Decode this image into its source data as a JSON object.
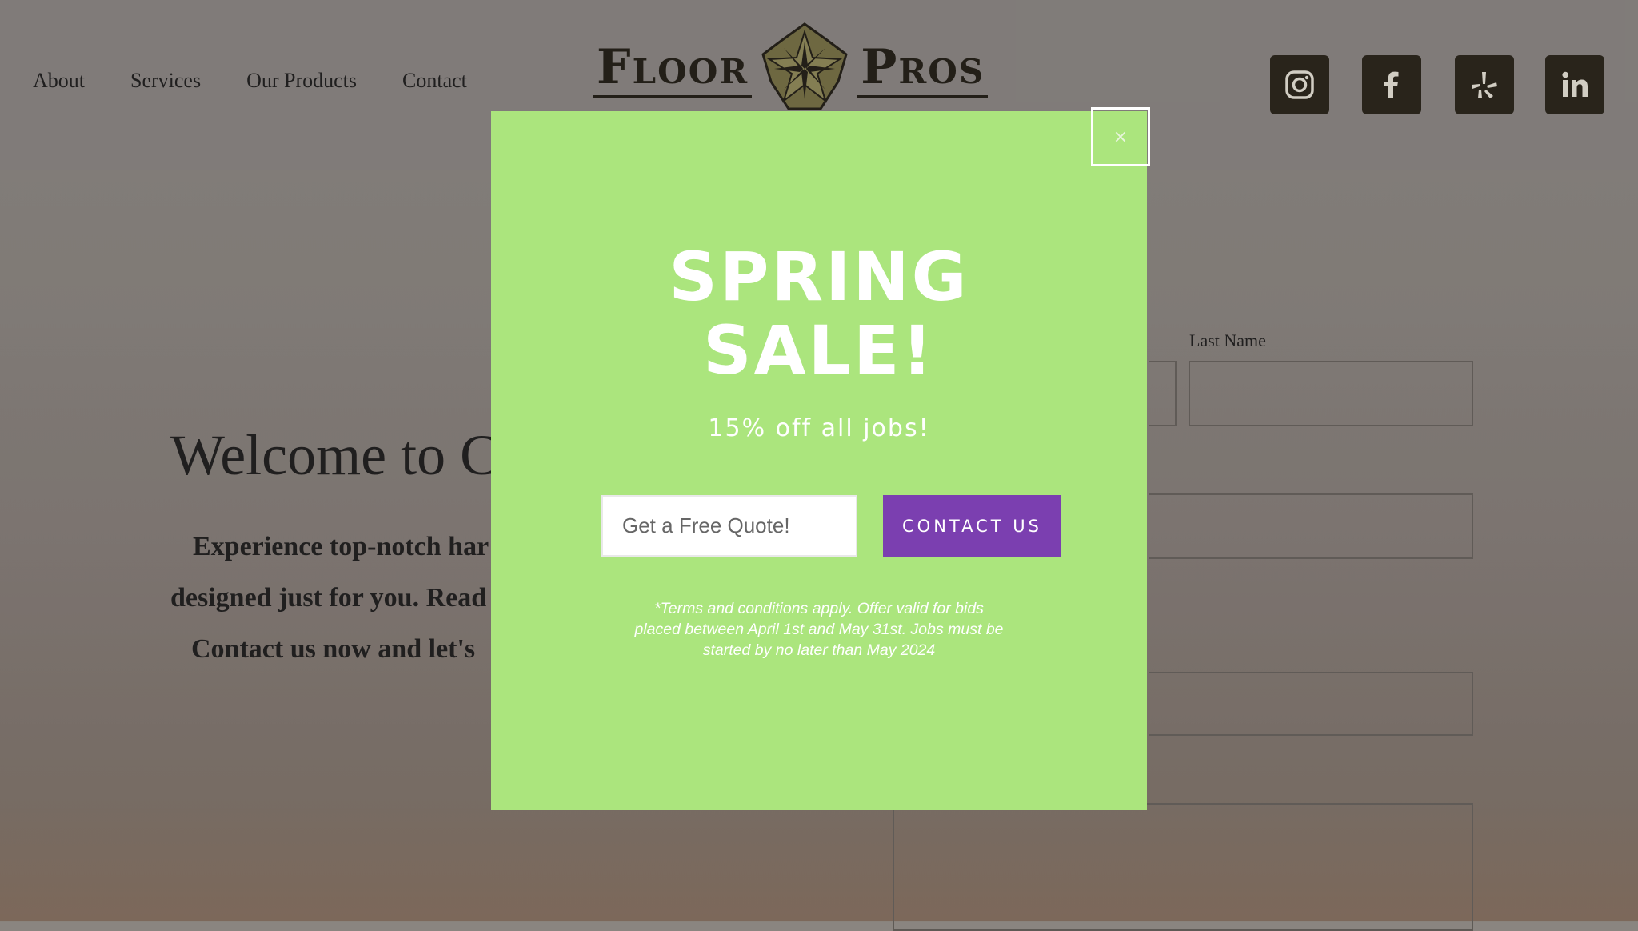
{
  "nav": {
    "items": [
      "About",
      "Services",
      "Our Products",
      "Contact"
    ]
  },
  "logo": {
    "left_word": "Floor",
    "right_word": "Pros",
    "emblem_icon": "star-emblem-icon"
  },
  "social": [
    {
      "name": "instagram",
      "icon": "instagram-icon"
    },
    {
      "name": "facebook",
      "icon": "facebook-icon"
    },
    {
      "name": "yelp",
      "icon": "yelp-icon"
    },
    {
      "name": "linkedin",
      "icon": "linkedin-icon"
    }
  ],
  "page": {
    "welcome": "Welcome to C",
    "intro_lines": [
      "Experience top-notch har",
      "designed just for you. Read",
      "Contact us now and let's"
    ]
  },
  "form": {
    "last_name_label": "Last Name"
  },
  "popup": {
    "close_label": "×",
    "title_line1": "SPRING",
    "title_line2": "SALE!",
    "subtitle": "15% off all jobs!",
    "quote_placeholder": "Get a Free Quote!",
    "button_label": "CONTACT US",
    "terms_line1": "*Terms and conditions apply. Offer valid for bids",
    "terms_line2": "placed between April 1st and May 31st. Jobs must be",
    "terms_line3": "started by no later than May 2024"
  },
  "colors": {
    "popup_bg": "#abe57d",
    "button_bg": "#7b3fb0",
    "social_bg": "#1c160b"
  }
}
